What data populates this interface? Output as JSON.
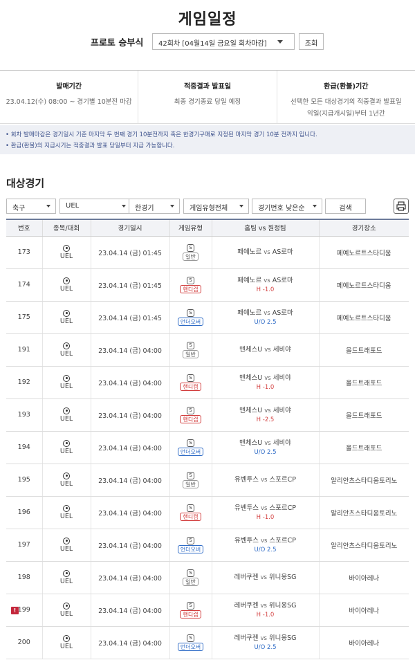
{
  "page_title": "게임일정",
  "round": {
    "label": "프로토 승부식",
    "selected": "42회차 [04월14일 금요일 회차마감]",
    "button": "조회"
  },
  "info": [
    {
      "heading": "발매기간",
      "lines": [
        "23.04.12(수) 08:00 ~ 경기별 10분전 마감"
      ]
    },
    {
      "heading": "적중결과 발표일",
      "lines": [
        "최종 경기종료 당일 예정"
      ]
    },
    {
      "heading": "환급(환불)기간",
      "lines": [
        "선택한 모든 대상경기의 적중결과 발표일",
        "익일(지급개시일)부터 1년간"
      ]
    }
  ],
  "notices": [
    "• 회차 발매마감은 경기일시 기준 마지막 두 번째 경기 10분전까지 혹은 한경기구매로 지정된 마지막 경기 10분 전까지 입니다.",
    "• 환급(환불)의 지급시기는 적중결과 발표 당일부터 지급 가능합니다."
  ],
  "section_title": "대상경기",
  "filters": {
    "sport": "축구",
    "league": "UEL",
    "mode": "한경기",
    "game_type": "게임유형전체",
    "sort": "경기번호 낮은순",
    "search": "검색"
  },
  "columns": [
    "번호",
    "종목/대회",
    "경기일시",
    "게임유형",
    "홈팀 vs 원정팀",
    "경기장소"
  ],
  "icons": {
    "sport": "soccer-ball-icon",
    "game": "s-badge-icon",
    "print": "printer-icon",
    "alert": "alert-icon"
  },
  "colors": {
    "handicap": "#d23c3c",
    "overunder": "#2e6bc6",
    "alert": "#c4263b"
  },
  "vs_text": "vs",
  "rows": [
    {
      "num": "173",
      "league": "UEL",
      "date": "23.04.14 (금) 01:45",
      "s": "S",
      "type": "일반",
      "kind": "normal",
      "home": "페예노르",
      "away": "AS로마",
      "sub": "",
      "venue": "페예노르트스타디움",
      "alert": ""
    },
    {
      "num": "174",
      "league": "UEL",
      "date": "23.04.14 (금) 01:45",
      "s": "S",
      "type": "핸디캡",
      "kind": "hc",
      "home": "페예노르",
      "away": "AS로마",
      "sub": "H -1.0",
      "venue": "페예노르트스타디움",
      "alert": ""
    },
    {
      "num": "175",
      "league": "UEL",
      "date": "23.04.14 (금) 01:45",
      "s": "S",
      "type": "언더오버",
      "kind": "ou",
      "home": "페예노르",
      "away": "AS로마",
      "sub": "U/O 2.5",
      "venue": "페예노르트스타디움",
      "alert": ""
    },
    {
      "num": "191",
      "league": "UEL",
      "date": "23.04.14 (금) 04:00",
      "s": "S",
      "type": "일반",
      "kind": "normal",
      "home": "맨체스U",
      "away": "세비야",
      "sub": "",
      "venue": "올드트래포드",
      "alert": ""
    },
    {
      "num": "192",
      "league": "UEL",
      "date": "23.04.14 (금) 04:00",
      "s": "S",
      "type": "핸디캡",
      "kind": "hc",
      "home": "맨체스U",
      "away": "세비야",
      "sub": "H -1.0",
      "venue": "올드트래포드",
      "alert": ""
    },
    {
      "num": "193",
      "league": "UEL",
      "date": "23.04.14 (금) 04:00",
      "s": "S",
      "type": "핸디캡",
      "kind": "hc",
      "home": "맨체스U",
      "away": "세비야",
      "sub": "H -2.5",
      "venue": "올드트래포드",
      "alert": ""
    },
    {
      "num": "194",
      "league": "UEL",
      "date": "23.04.14 (금) 04:00",
      "s": "S",
      "type": "언더오버",
      "kind": "ou",
      "home": "맨체스U",
      "away": "세비야",
      "sub": "U/O 2.5",
      "venue": "올드트래포드",
      "alert": ""
    },
    {
      "num": "195",
      "league": "UEL",
      "date": "23.04.14 (금) 04:00",
      "s": "S",
      "type": "일반",
      "kind": "normal",
      "home": "유벤투스",
      "away": "스포르CP",
      "sub": "",
      "venue": "알리안츠스타디움토리노",
      "alert": ""
    },
    {
      "num": "196",
      "league": "UEL",
      "date": "23.04.14 (금) 04:00",
      "s": "S",
      "type": "핸디캡",
      "kind": "hc",
      "home": "유벤투스",
      "away": "스포르CP",
      "sub": "H -1.0",
      "venue": "알리안츠스타디움토리노",
      "alert": ""
    },
    {
      "num": "197",
      "league": "UEL",
      "date": "23.04.14 (금) 04:00",
      "s": "S",
      "type": "언더오버",
      "kind": "ou",
      "home": "유벤투스",
      "away": "스포르CP",
      "sub": "U/O 2.5",
      "venue": "알리안츠스타디움토리노",
      "alert": ""
    },
    {
      "num": "198",
      "league": "UEL",
      "date": "23.04.14 (금) 04:00",
      "s": "S",
      "type": "일반",
      "kind": "normal",
      "home": "레버쿠젠",
      "away": "위니옹SG",
      "sub": "",
      "venue": "바이아레나",
      "alert": ""
    },
    {
      "num": "199",
      "league": "UEL",
      "date": "23.04.14 (금) 04:00",
      "s": "S",
      "type": "핸디캡",
      "kind": "hc",
      "home": "레버쿠젠",
      "away": "위니옹SG",
      "sub": "H -1.0",
      "venue": "바이아레나",
      "alert": "!"
    },
    {
      "num": "200",
      "league": "UEL",
      "date": "23.04.14 (금) 04:00",
      "s": "S",
      "type": "언더오버",
      "kind": "ou",
      "home": "레버쿠젠",
      "away": "위니옹SG",
      "sub": "U/O 2.5",
      "venue": "바이아레나",
      "alert": ""
    }
  ]
}
